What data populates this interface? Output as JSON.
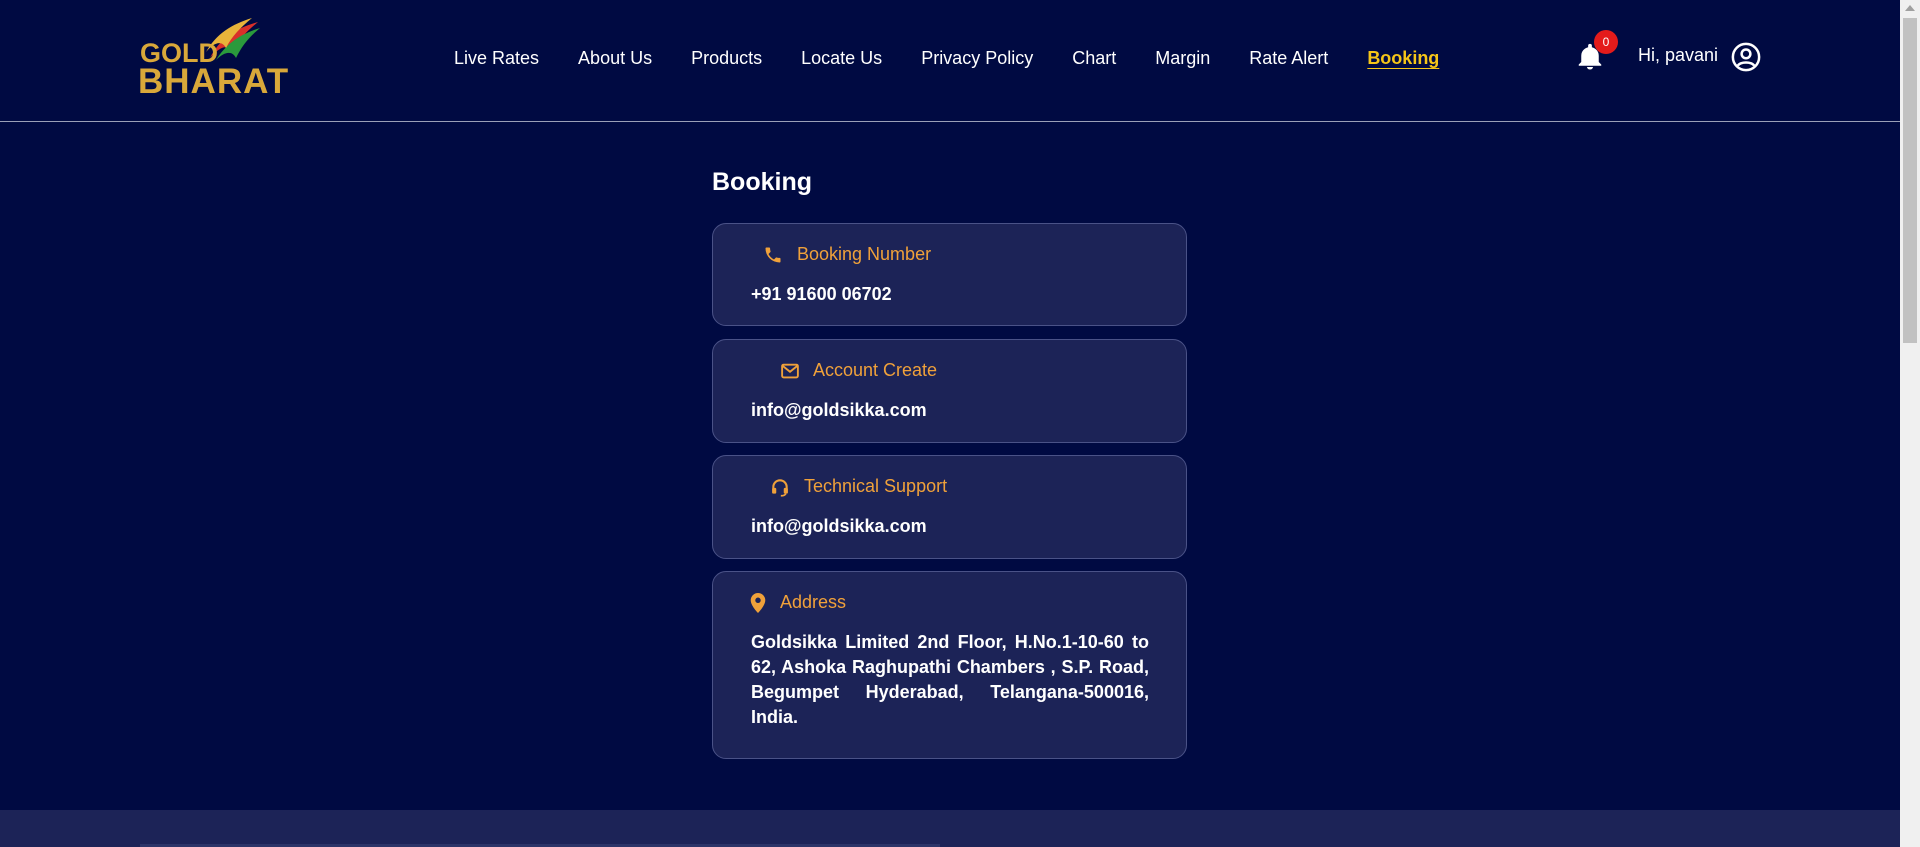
{
  "brand": {
    "line1": "GOLD",
    "line2": "BHARAT",
    "color": "#d9a83a"
  },
  "nav": {
    "items": [
      {
        "label": "Live Rates"
      },
      {
        "label": "About Us"
      },
      {
        "label": "Products"
      },
      {
        "label": "Locate Us"
      },
      {
        "label": "Privacy Policy"
      },
      {
        "label": "Chart"
      },
      {
        "label": "Margin"
      },
      {
        "label": "Rate Alert"
      },
      {
        "label": "Booking"
      }
    ],
    "active": "Booking"
  },
  "notifications": {
    "icon": "bell-icon",
    "count": "0"
  },
  "user": {
    "greeting": "Hi, pavani",
    "icon": "user-circle-icon"
  },
  "main": {
    "title": "Booking",
    "cards": [
      {
        "icon": "phone-icon",
        "label": "Booking Number",
        "value": "+91 91600 06702"
      },
      {
        "icon": "envelope-icon",
        "label": "Account Create",
        "value": "info@goldsikka.com"
      },
      {
        "icon": "headset-icon",
        "label": "Technical Support",
        "value": "info@goldsikka.com"
      },
      {
        "icon": "location-pin-icon",
        "label": "Address",
        "value": "Goldsikka Limited 2nd Floor, H.No.1-10-60 to 62, Ashoka Raghupathi Chambers , S.P. Road, Begumpet Hyderabad, Telangana-500016, India."
      }
    ]
  },
  "colors": {
    "background": "#000a42",
    "card": "#1c2357",
    "accent_label": "#f0a13a",
    "active_nav": "#f5c518",
    "badge": "#e41b1b"
  }
}
